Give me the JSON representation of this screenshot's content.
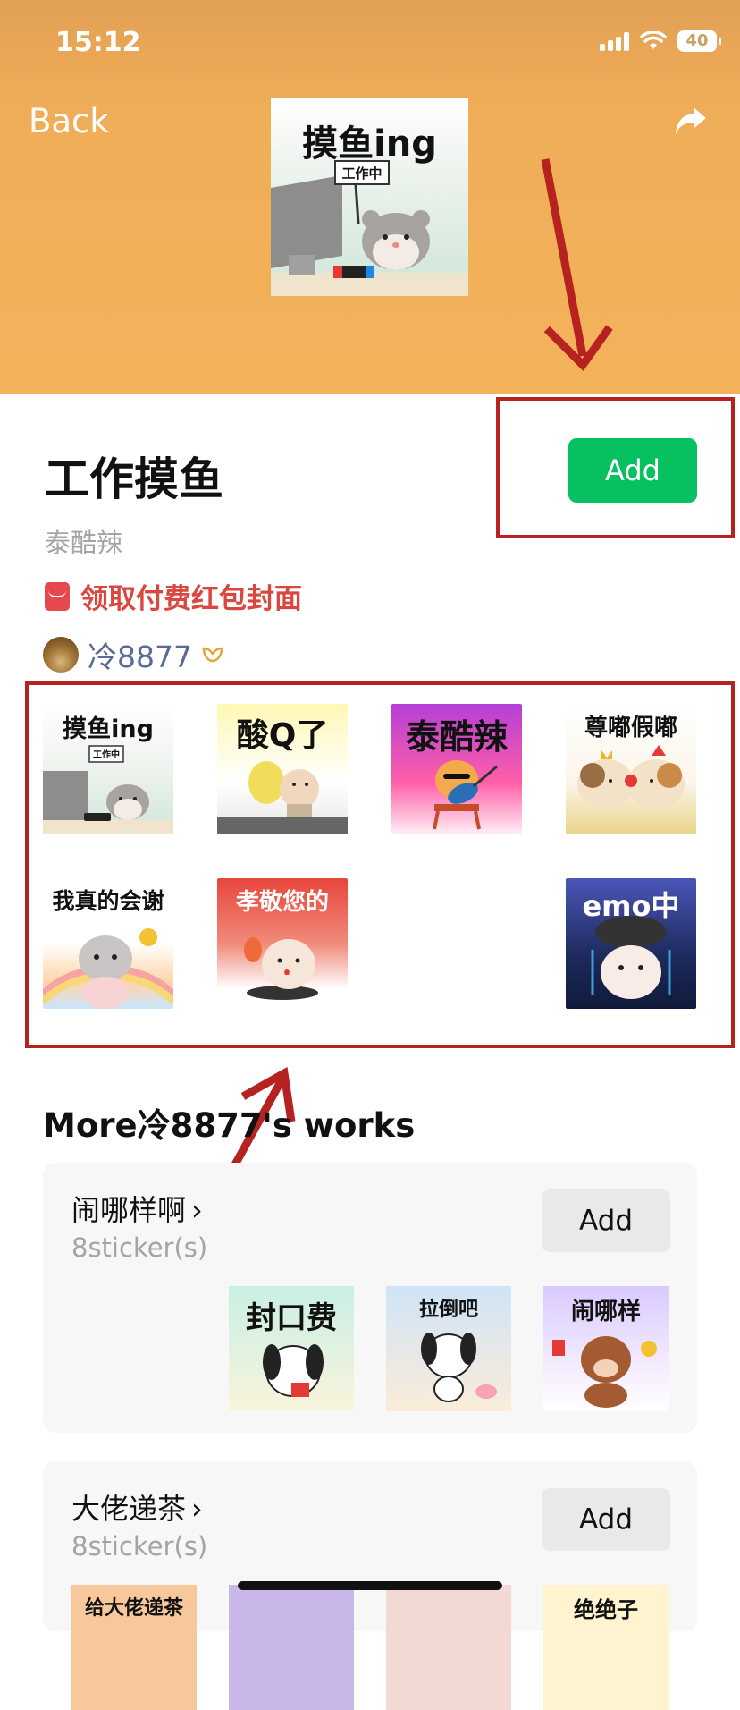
{
  "status_bar": {
    "time": "15:12",
    "battery": "40"
  },
  "nav": {
    "back_label": "Back"
  },
  "cover": {
    "title": "摸鱼ing",
    "sign": "工作中"
  },
  "pack": {
    "title": "工作摸鱼",
    "author": "泰酷辣",
    "add_label": "Add",
    "red_packet_label": "领取付费红包封面",
    "creator_name": "冷8877"
  },
  "stickers": [
    {
      "label": "摸鱼ing",
      "sign": "工作中"
    },
    {
      "label": "酸Q了"
    },
    {
      "label": "泰酷辣"
    },
    {
      "label": "尊嘟假嘟"
    },
    {
      "label": "我真的会谢"
    },
    {
      "label": "孝敬您的"
    },
    {
      "label": ""
    },
    {
      "label": "emo中"
    }
  ],
  "more": {
    "title": "More冷8877's works",
    "packs": [
      {
        "name": "闹哪样啊",
        "count": "8sticker(s)",
        "add_label": "Add",
        "previews": [
          "封口费",
          "拉倒吧",
          "闹哪样"
        ]
      },
      {
        "name": "大佬递茶",
        "count": "8sticker(s)",
        "add_label": "Add",
        "previews": [
          "给大佬递茶",
          "",
          "",
          "绝绝子"
        ]
      }
    ]
  },
  "colors": {
    "hero_bg": "#f3b25a",
    "add_green": "#07c160",
    "red_packet": "#d9473f",
    "link_blue": "#576b95",
    "annotation_red": "#b52220"
  }
}
